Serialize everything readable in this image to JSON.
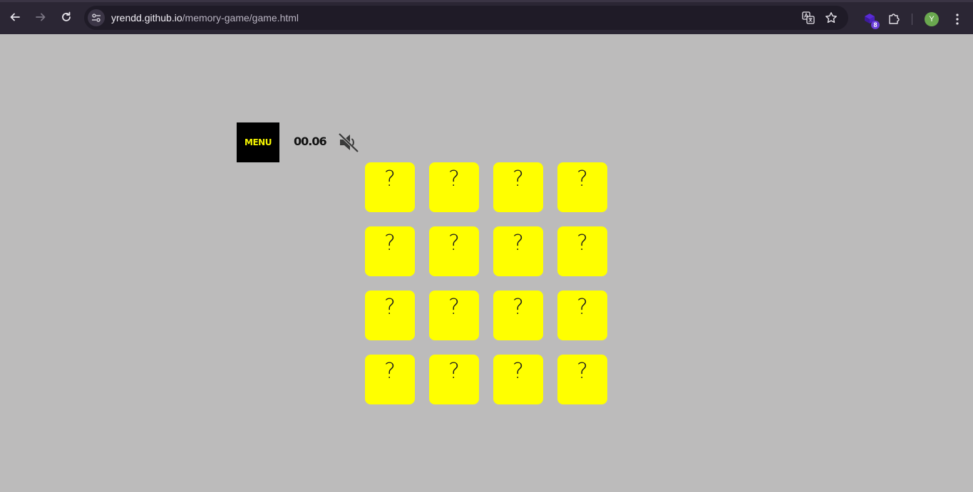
{
  "browser": {
    "url_host": "yrendd.github.io",
    "url_path": "/memory-game/game.html",
    "extension_badge": "8",
    "profile_initial": "Y"
  },
  "game": {
    "menu_label": "MENU",
    "timer": "00.06",
    "sound": "muted",
    "cards": [
      "?",
      "?",
      "?",
      "?",
      "?",
      "?",
      "?",
      "?",
      "?",
      "?",
      "?",
      "?",
      "?",
      "?",
      "?",
      "?"
    ],
    "colors": {
      "background": "#bcbbbb",
      "card": "#ffff00",
      "menu_bg": "#000000",
      "menu_text": "#f5f500"
    }
  }
}
